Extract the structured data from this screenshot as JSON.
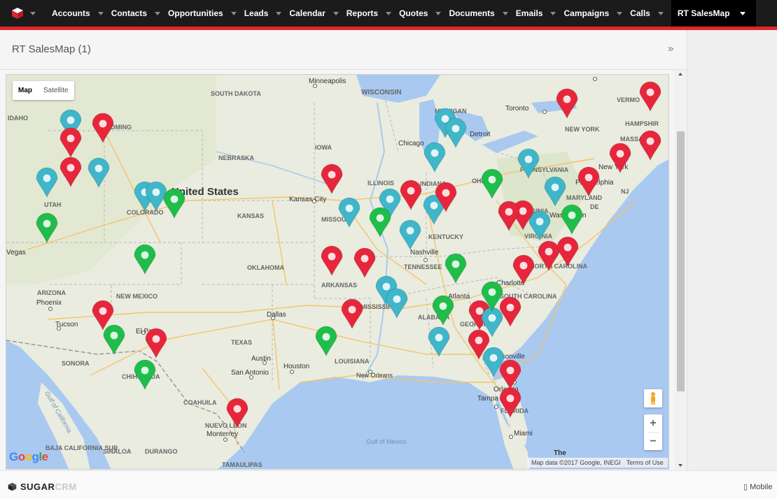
{
  "nav": {
    "items": [
      {
        "label": "Accounts"
      },
      {
        "label": "Contacts"
      },
      {
        "label": "Opportunities"
      },
      {
        "label": "Leads"
      },
      {
        "label": "Calendar"
      },
      {
        "label": "Reports"
      },
      {
        "label": "Quotes"
      },
      {
        "label": "Documents"
      },
      {
        "label": "Emails"
      },
      {
        "label": "Campaigns"
      },
      {
        "label": "Calls"
      }
    ],
    "active_label": "RT SalesMap"
  },
  "page": {
    "title": "RT SalesMap",
    "count": "(1)",
    "collapse_icon": "»"
  },
  "map": {
    "type_map": "Map",
    "type_satellite": "Satellite",
    "zoom_in": "+",
    "zoom_out": "−",
    "attribution": "Map data ©2017 Google, INEGI",
    "terms": "Terms of Use",
    "google": "Google",
    "labels": {
      "minneapolis": "Minneapolis",
      "south_dakota": "SOUTH DAKOTA",
      "wisconsin": "WISCONSIN",
      "michigan": "MICHIGAN",
      "toronto": "Toronto",
      "vermont": "VERMO",
      "idaho": "IDAHO",
      "wyoming": "WYOMING",
      "detroit": "Detroit",
      "new_york": "NEW YORK",
      "new_hampshire": "HAMPSHIR",
      "chicago": "Chicago",
      "iowa": "IOWA",
      "massachusetts": "MASSACHUS",
      "nebraska": "NEBRASKA",
      "pennsylvania": "PENNSYLVANIA",
      "new_york_city": "New York",
      "united_states": "United States",
      "illinois": "ILLINOIS",
      "indiana": "INDIANA",
      "ohio": "OHIO",
      "philadelphia": "Philadelphia",
      "nj": "NJ",
      "utah": "UTAH",
      "colorado": "COLORADO",
      "kansas_city": "Kansas City",
      "maryland": "MARYLAND",
      "de": "DE",
      "kansas": "KANSAS",
      "missouri": "MISSOURI",
      "west_virginia": "WEST VIRGINIA",
      "washington": "Washington",
      "kentucky": "KENTUCKY",
      "vegas": "Vegas",
      "virginia": "VIRGINIA",
      "nashville": "Nashville",
      "oklahoma": "OKLAHOMA",
      "tennessee": "TENNESSEE",
      "north_carolina": "NORTH CAROLINA",
      "charlotte": "Charlotte",
      "arizona": "ARIZONA",
      "new_mexico": "NEW MEXICO",
      "arkansas": "ARKANSAS",
      "phoenix": "Phoenix",
      "mississippi": "MISSISSIPPI",
      "atlanta": "Atlanta",
      "south_carolina": "SOUTH CAROLINA",
      "dallas": "Dallas",
      "alabama": "ALABAMA",
      "georgia": "GEORGIA",
      "tucson": "Tucson",
      "el_paso": "El Paso",
      "texas": "TEXAS",
      "louisiana": "LOUISIANA",
      "jacksonville": "Jacksonville",
      "sonora": "SONORA",
      "austin": "Austin",
      "houston": "Houston",
      "san_antonio": "San Antonio",
      "new_orleans": "New Orleans",
      "chihuahua": "CHIHUAHUA",
      "orlando": "Orlando",
      "tampa": "Tampa",
      "coahuila": "COAHUILA",
      "florida": "FLORIDA",
      "gulf_california": "Gulf of California",
      "nuevo_leon": "NUEVO LEON",
      "monterrey": "Monterrey",
      "miami": "Miami",
      "gulf_mexico": "Gulf of Mexico",
      "baja": "BAJA CALIFORNIA SUR",
      "sinaloa": "SINALOA",
      "durango": "DURANGO",
      "tamaulipas": "TAMAULIPAS",
      "the": "The"
    },
    "marker_colors": {
      "red": "#e8263b",
      "green": "#1fbd4a",
      "blue": "#3fb6c9"
    },
    "markers": [
      {
        "color": "blue"
      },
      {
        "color": "red"
      },
      {
        "color": "red"
      },
      {
        "color": "red"
      },
      {
        "color": "blue"
      },
      {
        "color": "blue"
      },
      {
        "color": "green"
      },
      {
        "color": "blue"
      },
      {
        "color": "blue"
      },
      {
        "color": "green"
      },
      {
        "color": "red"
      },
      {
        "color": "blue"
      },
      {
        "color": "blue"
      },
      {
        "color": "blue"
      },
      {
        "color": "red"
      },
      {
        "color": "blue"
      },
      {
        "color": "red"
      },
      {
        "color": "green"
      },
      {
        "color": "blue"
      },
      {
        "color": "red"
      },
      {
        "color": "blue"
      },
      {
        "color": "green"
      },
      {
        "color": "red"
      },
      {
        "color": "blue"
      },
      {
        "color": "red"
      },
      {
        "color": "green"
      },
      {
        "color": "red"
      },
      {
        "color": "blue"
      },
      {
        "color": "green"
      },
      {
        "color": "red"
      },
      {
        "color": "red"
      },
      {
        "color": "red"
      },
      {
        "color": "red"
      },
      {
        "color": "green"
      },
      {
        "color": "red"
      },
      {
        "color": "blue"
      },
      {
        "color": "blue"
      },
      {
        "color": "red"
      },
      {
        "color": "green"
      },
      {
        "color": "blue"
      },
      {
        "color": "green"
      },
      {
        "color": "red"
      },
      {
        "color": "green"
      },
      {
        "color": "blue"
      },
      {
        "color": "red"
      },
      {
        "color": "red"
      },
      {
        "color": "blue"
      },
      {
        "color": "red"
      },
      {
        "color": "red"
      },
      {
        "color": "blue"
      },
      {
        "color": "red"
      },
      {
        "color": "red"
      },
      {
        "color": "green"
      },
      {
        "color": "red"
      },
      {
        "color": "green"
      },
      {
        "color": "blue"
      },
      {
        "color": "red"
      },
      {
        "color": "red"
      },
      {
        "color": "red"
      }
    ]
  },
  "footer": {
    "brand_sugar": "SUGAR",
    "brand_crm": "CRM",
    "mobile": "Mobile",
    "mobile_icon": "phone-icon"
  }
}
